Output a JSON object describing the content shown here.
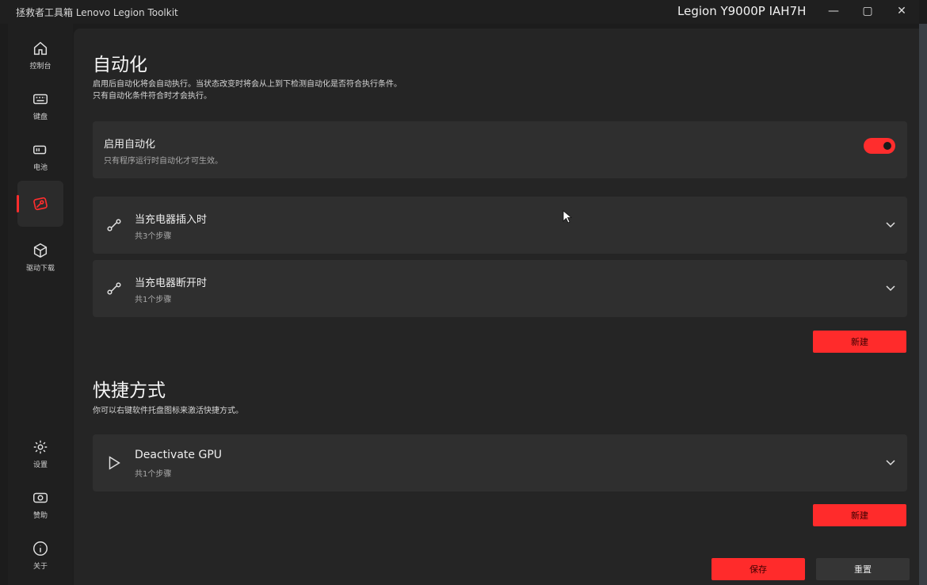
{
  "window": {
    "app_title": "拯救者工具箱 Lenovo Legion Toolkit",
    "device_name": "Legion Y9000P IAH7H",
    "minimize": "—",
    "maximize": "▢",
    "close": "✕"
  },
  "sidebar": {
    "items": [
      {
        "label": "控制台",
        "icon": "home-icon"
      },
      {
        "label": "键盘",
        "icon": "keyboard-icon"
      },
      {
        "label": "电池",
        "icon": "battery-icon"
      },
      {
        "label": "",
        "icon": "automation-icon",
        "active": true
      },
      {
        "label": "驱动下载",
        "icon": "package-icon"
      }
    ],
    "bottom_items": [
      {
        "label": "设置",
        "icon": "gear-icon"
      },
      {
        "label": "赞助",
        "icon": "donate-icon"
      },
      {
        "label": "关于",
        "icon": "info-icon"
      }
    ]
  },
  "automation": {
    "title": "自动化",
    "desc_line1": "启用后自动化将会自动执行。当状态改变时将会从上到下检测自动化是否符合执行条件。",
    "desc_line2": "只有自动化条件符合时才会执行。",
    "enable_card": {
      "title": "启用自动化",
      "subtitle": "只有程序运行时自动化才可生效。",
      "enabled": true
    },
    "pipelines": [
      {
        "title": "当充电器插入时",
        "steps": "共3个步骤",
        "icon": "link-icon"
      },
      {
        "title": "当充电器断开时",
        "steps": "共1个步骤",
        "icon": "link-icon"
      }
    ],
    "new_button": "新建"
  },
  "shortcuts": {
    "title": "快捷方式",
    "desc": "你可以右键软件托盘图标来激活快捷方式。",
    "items": [
      {
        "title": "Deactivate GPU",
        "steps": "共1个步骤",
        "icon": "play-icon"
      }
    ],
    "new_button": "新建"
  },
  "footer": {
    "save_button": "保存",
    "reset_button": "重置"
  },
  "colors": {
    "accent": "#ff2d2d",
    "background": "#1c1c1c",
    "card": "#2f2f2f"
  }
}
